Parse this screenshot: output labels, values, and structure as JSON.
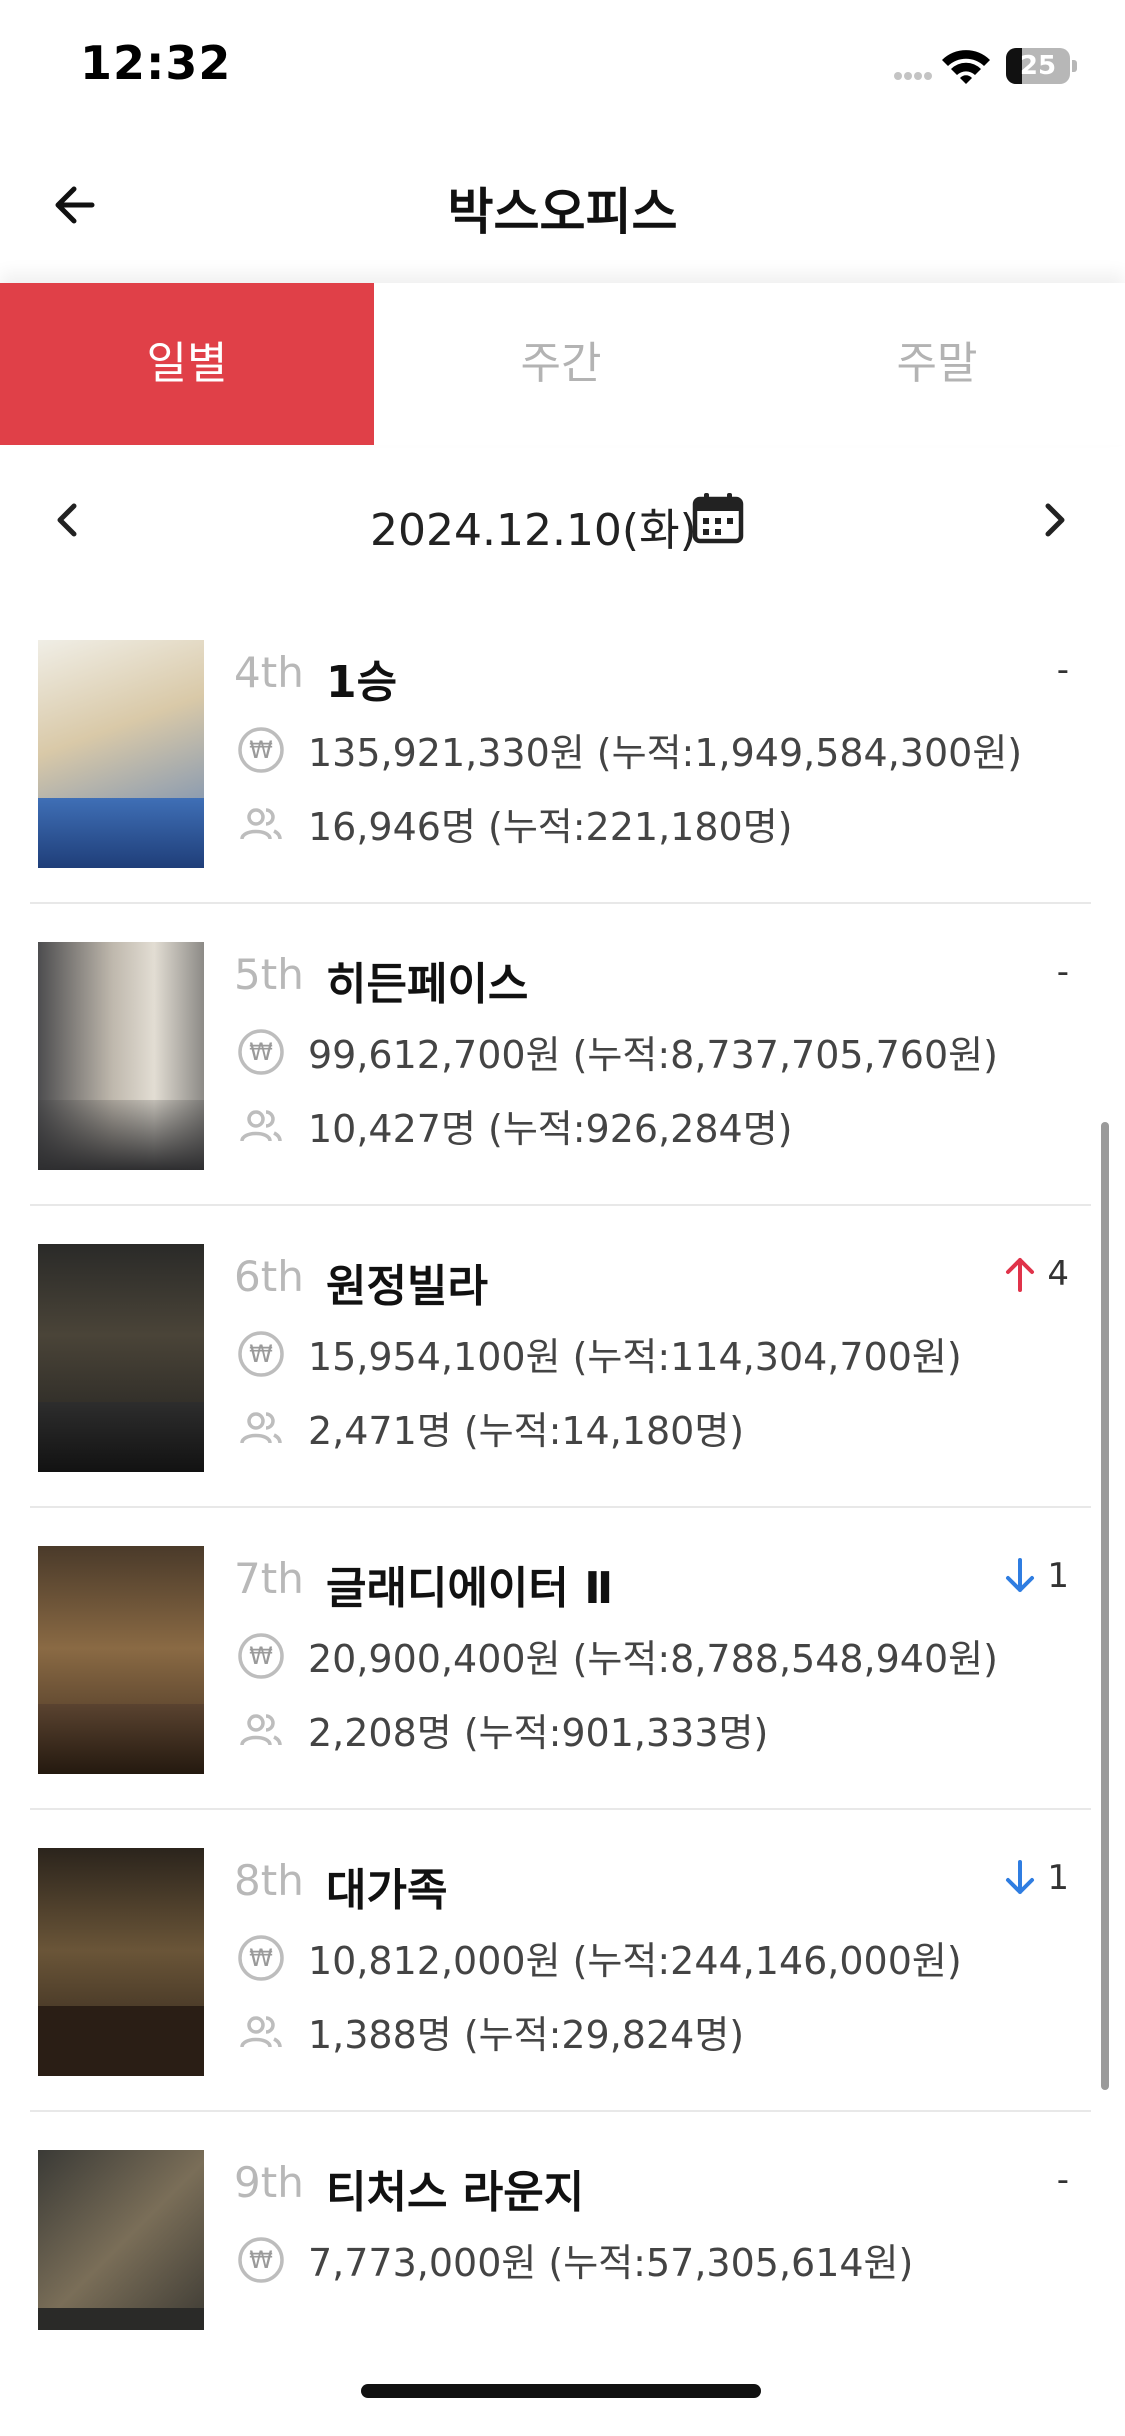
{
  "status_bar": {
    "time": "12:32",
    "battery": "25",
    "battery_level": 0.25
  },
  "header": {
    "title": "박스오피스",
    "back_icon": "arrow-left-icon"
  },
  "tabs": [
    {
      "label": "일별",
      "active": true
    },
    {
      "label": "주간",
      "active": false
    },
    {
      "label": "주말",
      "active": false
    }
  ],
  "date_nav": {
    "date": "2024.12.10(화)",
    "prev_icon": "chevron-left-icon",
    "next_icon": "chevron-right-icon",
    "calendar_icon": "calendar-icon"
  },
  "colors": {
    "accent": "#e04048",
    "rank_up": "#e0334a",
    "rank_down": "#2f7de1",
    "muted": "#b8b8b8"
  },
  "movies": [
    {
      "rank": "4th",
      "title": "1승",
      "change": "-",
      "change_dir": "none",
      "sales": "135,921,330원 (누적:1,949,584,300원)",
      "audience": "16,946명 (누적:221,180명)"
    },
    {
      "rank": "5th",
      "title": "히든페이스",
      "change": "-",
      "change_dir": "none",
      "sales": "99,612,700원 (누적:8,737,705,760원)",
      "audience": "10,427명 (누적:926,284명)"
    },
    {
      "rank": "6th",
      "title": "원정빌라",
      "change": "4",
      "change_dir": "up",
      "sales": "15,954,100원 (누적:114,304,700원)",
      "audience": "2,471명 (누적:14,180명)"
    },
    {
      "rank": "7th",
      "title": "글래디에이터 Ⅱ",
      "change": "1",
      "change_dir": "down",
      "sales": "20,900,400원 (누적:8,788,548,940원)",
      "audience": "2,208명 (누적:901,333명)"
    },
    {
      "rank": "8th",
      "title": "대가족",
      "change": "1",
      "change_dir": "down",
      "sales": "10,812,000원 (누적:244,146,000원)",
      "audience": "1,388명 (누적:29,824명)"
    },
    {
      "rank": "9th",
      "title": "티처스 라운지",
      "change": "-",
      "change_dir": "none",
      "sales": "7,773,000원 (누적:57,305,614원)",
      "audience": ""
    }
  ]
}
